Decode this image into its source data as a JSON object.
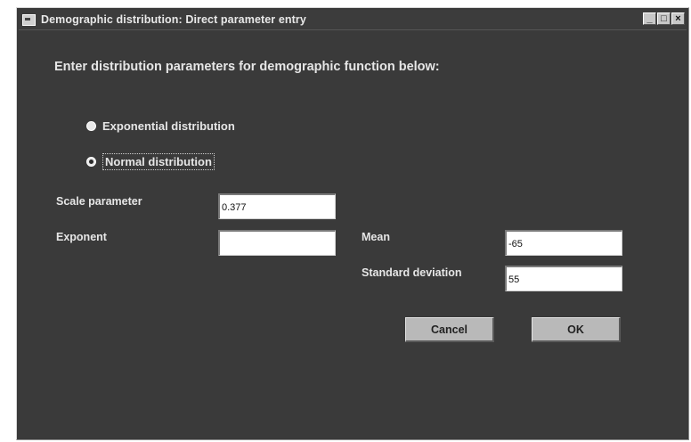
{
  "window": {
    "title": "Demographic distribution: Direct parameter entry",
    "controls": {
      "minimize": "_",
      "maximize": "□",
      "close": "×"
    }
  },
  "prompt": "Enter distribution parameters for demographic function below:",
  "distribution": {
    "options": [
      {
        "label": "Exponential distribution",
        "selected": false
      },
      {
        "label": "Normal distribution",
        "selected": true
      }
    ]
  },
  "fields": {
    "scale_parameter": {
      "label": "Scale parameter",
      "value": "0.377"
    },
    "exponent": {
      "label": "Exponent",
      "value": ""
    },
    "mean": {
      "label": "Mean",
      "value": "-65"
    },
    "standard_deviation": {
      "label": "Standard deviation",
      "value": "55"
    }
  },
  "buttons": {
    "cancel": "Cancel",
    "ok": "OK"
  }
}
